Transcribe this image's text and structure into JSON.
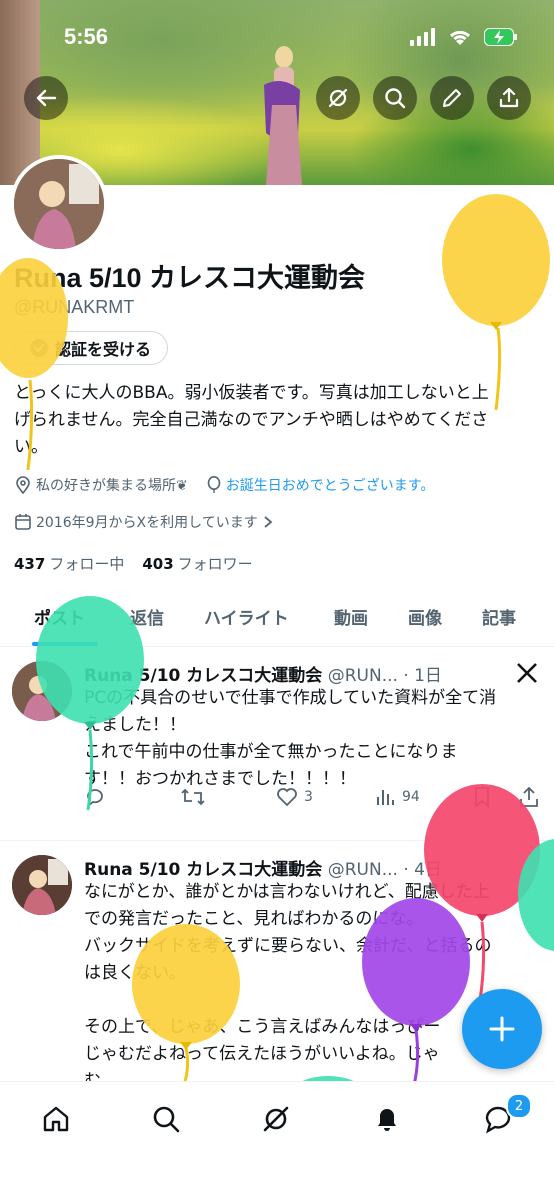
{
  "status_bar": {
    "time": "5:56"
  },
  "profile": {
    "name": "Runa 5/10 カレスコ大運動会",
    "handle": "@RUNAKRMT",
    "verify_label": "認証を受ける",
    "bio_lines": [
      "とっくに大人のBBA。弱小仮装者です。写真は加工しないと上",
      "げられません。完全自己満なのでアンチや晒しはやめてくださ",
      "い。"
    ],
    "location": "私の好きが集まる場所❦",
    "birthday_link": "お誕生日おめでとうございます。",
    "joined": "2016年9月からXを利用しています",
    "following_count": "437",
    "following_label": "フォロー中",
    "followers_count": "403",
    "followers_label": "フォロワー"
  },
  "tabs": [
    "ポスト",
    "返信",
    "ハイライト",
    "動画",
    "画像",
    "記事"
  ],
  "posts": [
    {
      "name": "Runa 5/10 カレスコ大運動会",
      "handle": "@RUN...",
      "time": "· 1日",
      "text": "PCの不具合のせいで仕事で作成していた資料が全て消\nえました！！\nこれで午前中の仕事が全て無かったことになりま\nす！！おつかれさまでした！！！！",
      "likes": "3",
      "views": "94"
    },
    {
      "name": "Runa 5/10 カレスコ大運動会",
      "handle": "@RUN...",
      "time": "· 4日",
      "text": "なにがとか、誰がとかは言わないけれど、配慮した上\nでの発言だったこと、見ればわかるのにな。\nバックサイドを考えずに要らない、余計だ、と括るの\nは良くない。\n\nその上で、じゃあ、こう言えばみんなはっぴー\nじゃむだよねって伝えたほうがいいよね。じゃ\nむ。"
    }
  ],
  "notifications_badge": "2",
  "colors": {
    "accent": "#1d9bf0",
    "text": "#0f1419",
    "secondary": "#536471"
  },
  "icons": [
    "back-arrow-icon",
    "grok-icon",
    "search-icon",
    "edit-pencil-icon",
    "share-icon",
    "verified-check-icon",
    "location-icon",
    "balloon-icon",
    "calendar-icon",
    "chevron-right-icon",
    "x-logo-icon",
    "reply-icon",
    "repost-icon",
    "like-icon",
    "views-icon",
    "bookmark-icon",
    "home-icon",
    "notifications-icon",
    "messages-icon",
    "compose-plus-icon"
  ]
}
